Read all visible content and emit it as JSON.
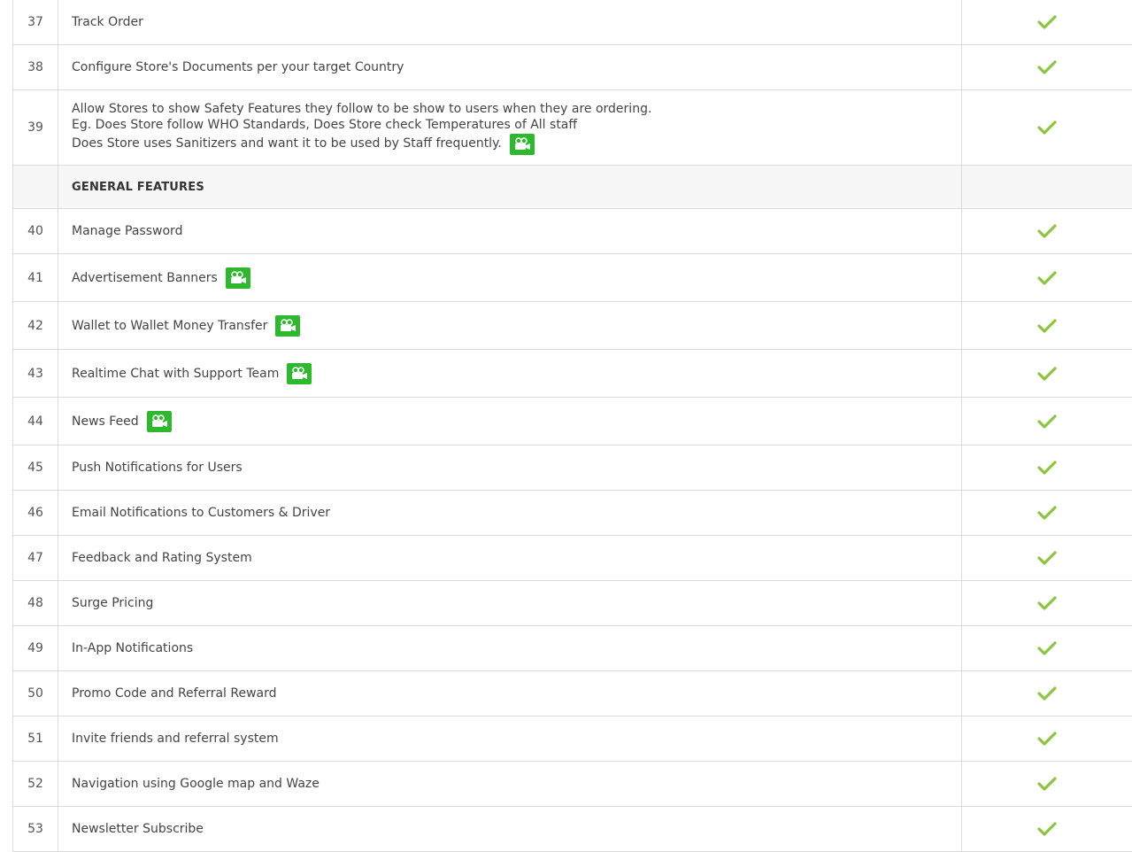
{
  "rows_before": [
    {
      "num": "37",
      "feature": "Track Order"
    },
    {
      "num": "38",
      "feature": "Configure Store's Documents per your target Country"
    }
  ],
  "row39": {
    "num": "39",
    "lines": [
      "Allow Stores to show Safety Features they follow to be show to users when they are ordering.",
      "Eg. Does Store follow WHO Standards, Does Store check Temperatures of All staff",
      "Does Store uses Sanitizers and want it to be used by Staff frequently."
    ]
  },
  "section": {
    "title": "GENERAL FEATURES"
  },
  "rows_after": [
    {
      "num": "40",
      "feature": "Manage Password"
    },
    {
      "num": "41",
      "feature": "Advertisement Banners"
    },
    {
      "num": "42",
      "feature": "Wallet to Wallet Money Transfer"
    },
    {
      "num": "43",
      "feature": "Realtime Chat with Support Team"
    },
    {
      "num": "44",
      "feature": "News Feed"
    },
    {
      "num": "45",
      "feature": "Push Notifications for Users"
    },
    {
      "num": "46",
      "feature": "Email Notifications to Customers & Driver"
    },
    {
      "num": "47",
      "feature": "Feedback and Rating System"
    },
    {
      "num": "48",
      "feature": "Surge Pricing"
    },
    {
      "num": "49",
      "feature": "In-App Notifications"
    },
    {
      "num": "50",
      "feature": "Promo Code and Referral Reward"
    },
    {
      "num": "51",
      "feature": "Invite friends and referral system"
    },
    {
      "num": "52",
      "feature": "Navigation using Google map and Waze"
    },
    {
      "num": "53",
      "feature": "Newsletter Subscribe"
    }
  ],
  "icons": {
    "check": "check-icon",
    "video": "video-camera-icon"
  },
  "colors": {
    "check": "#8cc63f",
    "video_badge": "#2db82d",
    "border": "#dcdcdc",
    "section_bg": "#f7f7f7"
  }
}
